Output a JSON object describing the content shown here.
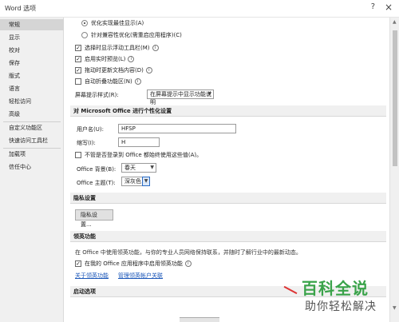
{
  "window": {
    "title": "Word 选项",
    "help": "?",
    "close": "×"
  },
  "sidebar": {
    "items": [
      {
        "label": "常规",
        "active": true
      },
      {
        "label": "显示"
      },
      {
        "label": "校对"
      },
      {
        "label": "保存"
      },
      {
        "label": "版式"
      },
      {
        "label": "语言"
      },
      {
        "label": "轻松访问"
      },
      {
        "label": "高级"
      },
      {
        "label": "自定义功能区"
      },
      {
        "label": "快速访问工具栏"
      },
      {
        "label": "加载项"
      },
      {
        "label": "信任中心"
      }
    ]
  },
  "ui_options": {
    "radio_optimize_display": "优化实现最佳显示(A)",
    "radio_optimize_compat": "针对兼容性优化(需重启应用程序)(C)",
    "cb_mini_toolbar": "选择时显示浮动工具栏(M)",
    "cb_live_preview": "启用实时预览(L)",
    "cb_update_drag": "拖动时更新文档内容(D)",
    "cb_collapse_ribbon": "自动折叠功能区(N)",
    "screentip_label": "屏幕提示样式(R):",
    "screentip_value": "在屏幕提示中显示功能说明"
  },
  "personalize": {
    "section_title": "对 Microsoft Office 进行个性化设置",
    "username_label": "用户名(U):",
    "username_value": "HFSP",
    "initials_label": "缩写(I):",
    "initials_value": "H",
    "always_use_label": "不管是否登录到 Office 都始终使用这些值(A)。",
    "background_label": "Office 背景(B):",
    "background_value": "春天",
    "theme_label": "Office 主题(T):",
    "theme_value": "深灰色"
  },
  "privacy": {
    "section_title": "隐私设置",
    "button_label": "隐私设置..."
  },
  "linkedin": {
    "section_title": "领英功能",
    "description": "在 Office 中使用领英功能，与你的专业人员网络保持联系，并随时了解行业中的最新动态。",
    "cb_enable": "在我的 Office 应用程序中启用领英功能",
    "link_about": "关于领英功能",
    "link_manage": "管理领英帐户关联"
  },
  "startup": {
    "section_title": "启动选项"
  },
  "watermark": {
    "line1": "百科全说",
    "line2": "助你轻松解决"
  }
}
